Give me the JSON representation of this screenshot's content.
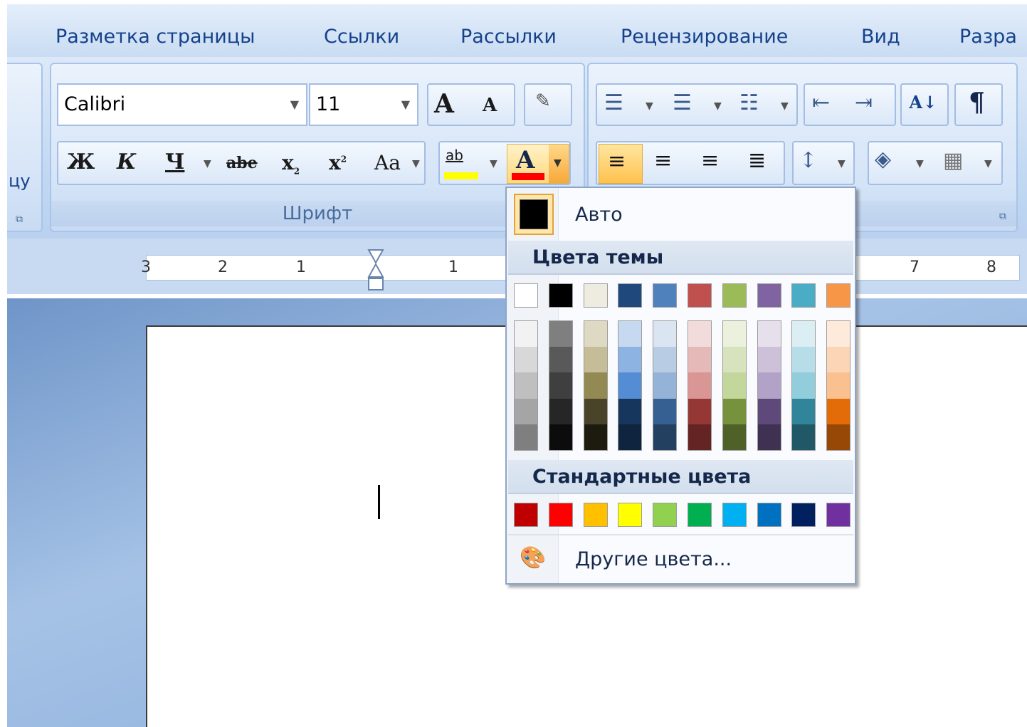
{
  "tabs": [
    "Разметка страницы",
    "Ссылки",
    "Рассылки",
    "Рецензирование",
    "Вид",
    "Разра"
  ],
  "ribbon": {
    "left_cut_text": "цу",
    "font_group": {
      "title": "Шрифт",
      "font_name": "Calibri",
      "font_size": "11",
      "grow_label": "A",
      "shrink_label": "A",
      "bold_label": "Ж",
      "italic_label": "К",
      "underline_label": "Ч",
      "strike_label": "abe",
      "subscript_label": "x",
      "superscript_label": "x",
      "case_label": "Aa",
      "highlight_label": "ab",
      "font_color_label": "A"
    },
    "paragraph_group": {
      "sort_label": "А↓",
      "pilcrow_label": "¶"
    }
  },
  "ruler": {
    "left_numbers": [
      "3",
      "2",
      "1"
    ],
    "right_numbers": [
      "1"
    ],
    "far_numbers": [
      "7",
      "8"
    ]
  },
  "color_menu": {
    "auto_label": "Авто",
    "theme_header": "Цвета темы",
    "standard_header": "Стандартные цвета",
    "more_colors_label": "Другие цвета...",
    "theme_colors": [
      "#ffffff",
      "#000000",
      "#eeece1",
      "#1f497d",
      "#4f81bd",
      "#c0504d",
      "#9bbb59",
      "#8064a2",
      "#4bacc6",
      "#f79646"
    ],
    "theme_shades": [
      [
        "#f2f2f2",
        "#d8d8d8",
        "#bfbfbf",
        "#a5a5a5",
        "#7f7f7f"
      ],
      [
        "#7f7f7f",
        "#595959",
        "#3f3f3f",
        "#262626",
        "#0c0c0c"
      ],
      [
        "#ddd9c3",
        "#c4bd97",
        "#938953",
        "#494429",
        "#1d1b10"
      ],
      [
        "#c6d9f0",
        "#8db3e2",
        "#548dd4",
        "#17365d",
        "#0f243e"
      ],
      [
        "#dbe5f1",
        "#b8cce4",
        "#95b3d7",
        "#366092",
        "#244061"
      ],
      [
        "#f2dcdb",
        "#e5b9b7",
        "#d99694",
        "#953734",
        "#632423"
      ],
      [
        "#ebf1dd",
        "#d7e3bc",
        "#c3d69b",
        "#76923c",
        "#4f6128"
      ],
      [
        "#e5e0ec",
        "#ccc1d9",
        "#b2a2c7",
        "#5f497a",
        "#3f3151"
      ],
      [
        "#dbeef3",
        "#b7dde8",
        "#92cddc",
        "#31859b",
        "#205867"
      ],
      [
        "#fdeada",
        "#fbd5b5",
        "#fac08f",
        "#e36c09",
        "#974806"
      ]
    ],
    "standard_colors": [
      "#c00000",
      "#ff0000",
      "#ffc000",
      "#ffff00",
      "#92d050",
      "#00b050",
      "#00b0f0",
      "#0070c0",
      "#002060",
      "#7030a0"
    ]
  }
}
